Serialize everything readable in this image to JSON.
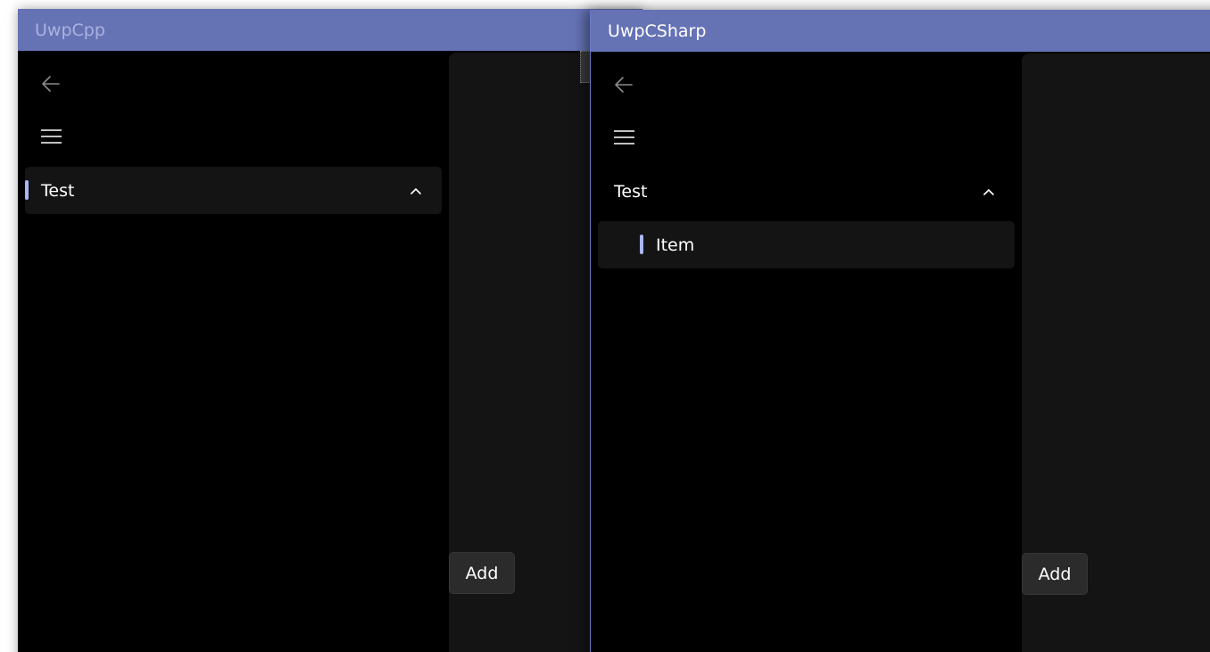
{
  "windows": {
    "cpp": {
      "title": "UwpCpp",
      "nav_items": [
        {
          "label": "Test",
          "selected": true,
          "expanded": true
        }
      ],
      "add_label": "Add"
    },
    "csharp": {
      "title": "UwpCSharp",
      "nav_items": [
        {
          "label": "Test",
          "selected": false,
          "expanded": true
        },
        {
          "label": "Item",
          "selected": true,
          "child": true
        }
      ],
      "add_label": "Add"
    }
  },
  "icons": {
    "back": "back-arrow-icon",
    "menu": "hamburger-menu-icon",
    "chevron": "chevron-up-icon"
  },
  "colors": {
    "titlebar": "#6572b4",
    "inactive_title_text": "#aab2e0",
    "active_title_text": "#ffffff",
    "window_background": "#000000",
    "content_pane": "#141414",
    "selection_pill": "#aab5f2",
    "button_background": "#2b2b2b"
  }
}
